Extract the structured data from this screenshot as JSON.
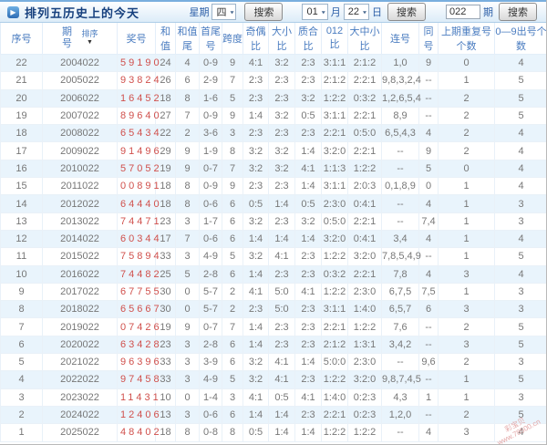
{
  "title": {
    "text": "排列五历史上的今天",
    "icon": "arrow-square-icon"
  },
  "toolbar": {
    "week_label": "星期",
    "week_value": "四",
    "search_label_1": "搜索",
    "month_value": "01",
    "month_label": "月",
    "day_value": "22",
    "day_label": "日",
    "search_label_2": "搜索",
    "issue_value": "022",
    "issue_label": "期",
    "search_label_3": "搜索"
  },
  "table": {
    "headers": [
      "序号",
      "期号",
      "奖号",
      "和值",
      "和值尾",
      "首尾号",
      "跨度",
      "奇偶比",
      "大小比",
      "质合比",
      "012比",
      "大中小比",
      "连号",
      "同号",
      "上期重复号个数",
      "0—9出号个数"
    ],
    "sort_label": "排序",
    "rows": [
      [
        "22",
        "2004022",
        "59190",
        "24",
        "4",
        "0-9",
        "9",
        "4:1",
        "3:2",
        "2:3",
        "3:1:1",
        "2:1:2",
        "1,0",
        "9",
        "0",
        "4"
      ],
      [
        "21",
        "2005022",
        "93824",
        "26",
        "6",
        "2-9",
        "7",
        "2:3",
        "2:3",
        "2:3",
        "2:1:2",
        "2:2:1",
        "9,8,3,2,4",
        "--",
        "1",
        "5"
      ],
      [
        "20",
        "2006022",
        "16452",
        "18",
        "8",
        "1-6",
        "5",
        "2:3",
        "2:3",
        "3:2",
        "1:2:2",
        "0:3:2",
        "1,2,6,5,4",
        "--",
        "2",
        "5"
      ],
      [
        "19",
        "2007022",
        "89640",
        "27",
        "7",
        "0-9",
        "9",
        "1:4",
        "3:2",
        "0:5",
        "3:1:1",
        "2:2:1",
        "8,9",
        "--",
        "2",
        "5"
      ],
      [
        "18",
        "2008022",
        "65434",
        "22",
        "2",
        "3-6",
        "3",
        "2:3",
        "2:3",
        "2:3",
        "2:2:1",
        "0:5:0",
        "6,5,4,3",
        "4",
        "2",
        "4"
      ],
      [
        "17",
        "2009022",
        "91496",
        "29",
        "9",
        "1-9",
        "8",
        "3:2",
        "3:2",
        "1:4",
        "3:2:0",
        "2:2:1",
        "--",
        "9",
        "2",
        "4"
      ],
      [
        "16",
        "2010022",
        "57052",
        "19",
        "9",
        "0-7",
        "7",
        "3:2",
        "3:2",
        "4:1",
        "1:1:3",
        "1:2:2",
        "--",
        "5",
        "0",
        "4"
      ],
      [
        "15",
        "2011022",
        "00891",
        "18",
        "8",
        "0-9",
        "9",
        "2:3",
        "2:3",
        "1:4",
        "3:1:1",
        "2:0:3",
        "0,1,8,9",
        "0",
        "1",
        "4"
      ],
      [
        "14",
        "2012022",
        "64440",
        "18",
        "8",
        "0-6",
        "6",
        "0:5",
        "1:4",
        "0:5",
        "2:3:0",
        "0:4:1",
        "--",
        "4",
        "1",
        "3"
      ],
      [
        "13",
        "2013022",
        "74471",
        "23",
        "3",
        "1-7",
        "6",
        "3:2",
        "2:3",
        "3:2",
        "0:5:0",
        "2:2:1",
        "--",
        "7,4",
        "1",
        "3"
      ],
      [
        "12",
        "2014022",
        "60344",
        "17",
        "7",
        "0-6",
        "6",
        "1:4",
        "1:4",
        "1:4",
        "3:2:0",
        "0:4:1",
        "3,4",
        "4",
        "1",
        "4"
      ],
      [
        "11",
        "2015022",
        "75894",
        "33",
        "3",
        "4-9",
        "5",
        "3:2",
        "4:1",
        "2:3",
        "1:2:2",
        "3:2:0",
        "7,8,5,4,9",
        "--",
        "1",
        "5"
      ],
      [
        "10",
        "2016022",
        "74482",
        "25",
        "5",
        "2-8",
        "6",
        "1:4",
        "2:3",
        "2:3",
        "0:3:2",
        "2:2:1",
        "7,8",
        "4",
        "3",
        "4"
      ],
      [
        "9",
        "2017022",
        "67755",
        "30",
        "0",
        "5-7",
        "2",
        "4:1",
        "5:0",
        "4:1",
        "1:2:2",
        "2:3:0",
        "6,7,5",
        "7,5",
        "1",
        "3"
      ],
      [
        "8",
        "2018022",
        "65667",
        "30",
        "0",
        "5-7",
        "2",
        "2:3",
        "5:0",
        "2:3",
        "3:1:1",
        "1:4:0",
        "6,5,7",
        "6",
        "3",
        "3"
      ],
      [
        "7",
        "2019022",
        "07426",
        "19",
        "9",
        "0-7",
        "7",
        "1:4",
        "2:3",
        "2:3",
        "2:2:1",
        "1:2:2",
        "7,6",
        "--",
        "2",
        "5"
      ],
      [
        "6",
        "2020022",
        "63428",
        "23",
        "3",
        "2-8",
        "6",
        "1:4",
        "2:3",
        "2:3",
        "2:1:2",
        "1:3:1",
        "3,4,2",
        "--",
        "3",
        "5"
      ],
      [
        "5",
        "2021022",
        "96396",
        "33",
        "3",
        "3-9",
        "6",
        "3:2",
        "4:1",
        "1:4",
        "5:0:0",
        "2:3:0",
        "--",
        "9,6",
        "2",
        "3"
      ],
      [
        "4",
        "2022022",
        "97458",
        "33",
        "3",
        "4-9",
        "5",
        "3:2",
        "4:1",
        "2:3",
        "1:2:2",
        "3:2:0",
        "9,8,7,4,5",
        "--",
        "1",
        "5"
      ],
      [
        "3",
        "2023022",
        "11431",
        "10",
        "0",
        "1-4",
        "3",
        "4:1",
        "0:5",
        "4:1",
        "1:4:0",
        "0:2:3",
        "4,3",
        "1",
        "1",
        "3"
      ],
      [
        "2",
        "2024022",
        "12406",
        "13",
        "3",
        "0-6",
        "6",
        "1:4",
        "1:4",
        "2:3",
        "2:2:1",
        "0:2:3",
        "1,2,0",
        "--",
        "2",
        "5"
      ],
      [
        "1",
        "2025022",
        "48402",
        "18",
        "8",
        "0-8",
        "8",
        "0:5",
        "1:4",
        "1:4",
        "1:2:2",
        "1:2:2",
        "--",
        "4",
        "3",
        "4"
      ]
    ]
  },
  "watermark": {
    "line1": "彩宝贝",
    "line2": "www.78500.cn"
  },
  "colors": {
    "accent_blue": "#4a7cc0",
    "title_navy": "#16407e",
    "prize_red": "#d0504c",
    "row_alt": "#e9f4fc"
  }
}
